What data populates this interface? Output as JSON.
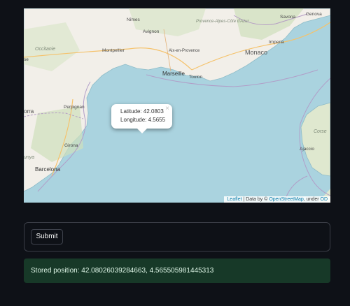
{
  "map": {
    "cities": [
      "Savona",
      "Genova",
      "Imperia",
      "Monaco",
      "Nîmes",
      "Avignon",
      "Montpellier",
      "Aix-en-Provence",
      "Marseille",
      "Toulon",
      "Perpignan",
      "Girona",
      "Barcelona",
      "Ajaccio"
    ],
    "regions": [
      "Occitanie",
      "Provence-Alpes-Côte d'Azur",
      "Corse"
    ],
    "partial_labels": [
      "se",
      "orra",
      "unya"
    ],
    "popup": {
      "line1": "Latitude: 42.0803",
      "line2": "Longitude: 4.5655",
      "close": "×"
    },
    "attribution": {
      "leaflet": "Leaflet",
      "sep": " | Data by © ",
      "osm": "OpenStreetMap",
      "under": ", under ",
      "odbl": "OD"
    },
    "colors": {
      "sea": "#aad3df",
      "land": "#f2efe9",
      "accent_link": "#0078a8"
    }
  },
  "form": {
    "submit_label": "Submit"
  },
  "status": {
    "text": "Stored position: 42.08026039284663, 4.565505981445313",
    "color": "#173928"
  }
}
